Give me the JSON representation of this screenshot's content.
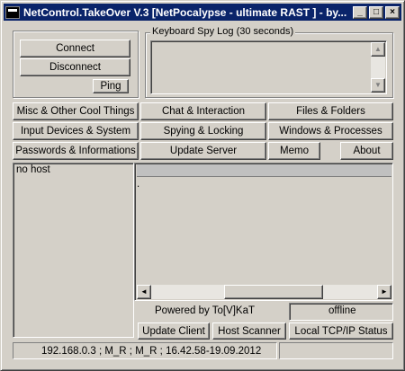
{
  "window": {
    "title": "NetControl.TakeOver V.3 [NetPocalypse - ultimate RAST ] - by...",
    "controls": {
      "minimize": "_",
      "maximize": "□",
      "close": "×"
    }
  },
  "connection": {
    "connect": "Connect",
    "disconnect": "Disconnect",
    "ping": "Ping"
  },
  "keylog": {
    "label": "Keyboard Spy Log (30 seconds)",
    "scroll_up": "▲",
    "scroll_down": "▼"
  },
  "menu": {
    "row1": [
      "Misc & Other Cool Things",
      "Chat & Interaction",
      "Files & Folders"
    ],
    "row2": [
      "Input Devices & System",
      "Spying & Locking",
      "Windows & Processes"
    ],
    "row3": [
      "Passwords & Informations",
      "Update Server",
      "Memo",
      "About"
    ]
  },
  "hosts": {
    "items": [
      "no host"
    ]
  },
  "output": {
    "text": ".",
    "scroll_left": "◄",
    "scroll_right": "►"
  },
  "footer": {
    "powered": "Powered by To[V]KaT",
    "status": "offline",
    "update_client": "Update Client",
    "host_scanner": "Host Scanner",
    "local_tcp": "Local TCP/IP Status"
  },
  "statusbar": {
    "info": "192.168.0.3 ; M_R ; M_R ; 16.42.58-19.09.2012"
  }
}
